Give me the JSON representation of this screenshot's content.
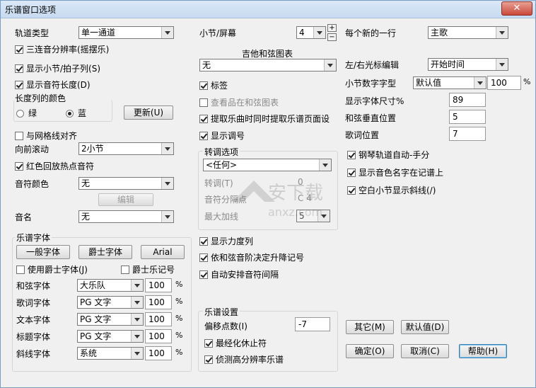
{
  "window": {
    "title": "乐谱窗口选项",
    "close": "✕"
  },
  "left": {
    "track_type_label": "轨道类型",
    "track_type_value": "单一通道",
    "triplet_cb": "三连音分辨率(摇摆乐)",
    "show_bar_beat_cb": "显示小节/拍子列(S)",
    "show_note_length_cb": "显示音符长度(D)",
    "length_color_label": "长度列的颜色",
    "radio_green": "绿",
    "radio_blue": "蓝",
    "update_btn": "更新(U)",
    "grid_align_cb": "与网格线对齐",
    "forward_scroll_label": "向前滚动",
    "forward_scroll_value": "2小节",
    "red_playback_cb": "红色回放热点音符",
    "note_color_label": "音符颜色",
    "note_color_value": "无",
    "edit_btn": "编辑",
    "note_name_label": "音名",
    "note_name_value": "无"
  },
  "fonts": {
    "group_label": "乐谱字体",
    "general_btn": "一般字体",
    "jazz_btn": "爵士字体",
    "arial_btn": "Arial",
    "use_jazz_cb": "使用爵士字体(J)",
    "jazz_symbols_cb": "爵士乐记号",
    "rows": [
      {
        "label": "和弦字体",
        "font": "大乐队",
        "size": "100",
        "unit": "%"
      },
      {
        "label": "歌词字体",
        "font": "PG 文字",
        "size": "100",
        "unit": "%"
      },
      {
        "label": "文本字体",
        "font": "PG 文字",
        "size": "100",
        "unit": "%"
      },
      {
        "label": "标题字体",
        "font": "PG 文字",
        "size": "100",
        "unit": "%"
      },
      {
        "label": "斜线字体",
        "font": "系统",
        "size": "100",
        "unit": "%"
      }
    ]
  },
  "middle": {
    "bars_per_screen_label": "小节/屏幕",
    "bars_per_screen_value": "4",
    "plus": "+",
    "minus": "−",
    "guitar_chord_label": "吉他和弦图表",
    "guitar_chord_value": "无",
    "tab_cb": "标签",
    "view_chord_cb": "查看品在和弦图表",
    "extract_page_cb": "提取乐曲时同时提取乐谱页面设",
    "show_key_cb": "显示调号",
    "transpose_group_label": "转调选项",
    "transpose_value": "<任何>",
    "transpose_label": "转调(T)",
    "transpose_num": "0",
    "split_point_label": "音符分隔点",
    "split_point_value": "C 4",
    "max_ledger_label": "最大加线",
    "max_ledger_value": "5",
    "show_dynamics_cb": "显示力度列",
    "sharps_flats_cb": "依和弦音阶决定升降记号",
    "auto_spacing_cb": "自动安排音符间隔",
    "score_settings_label": "乐谱设置",
    "offset_label": "偏移点数(I)",
    "offset_value": "-7",
    "minimize_rests_cb": "最经化休止符",
    "detect_hires_cb": "侦测高分辨率乐谱"
  },
  "right": {
    "new_line_label": "每个新的一行",
    "new_line_value": "主歌",
    "cursor_edit_label": "左/右光标编辑",
    "cursor_edit_value": "开始时间",
    "bar_number_font_label": "小节数字字型",
    "bar_number_font_value": "默认值",
    "bar_number_size": "100",
    "bar_number_unit": "%",
    "display_font_size_label": "显示字体尺寸%",
    "display_font_size_value": "89",
    "chord_vertical_label": "和弦垂直位置",
    "chord_vertical_value": "5",
    "lyric_position_label": "歌词位置",
    "lyric_position_value": "7",
    "piano_auto_cb": "钢琴轨道自动-手分",
    "show_color_names_cb": "显示音色名字在记谱上",
    "empty_bar_slash_cb": "空白小节显示斜线(/)",
    "other_btn": "其它(M)",
    "default_btn": "默认值(D)",
    "ok_btn": "确定(O)",
    "cancel_btn": "取消(C)",
    "help_btn": "帮助(H)"
  },
  "watermark": {
    "text_cn": "安下载",
    "text_en": "anxz.com"
  }
}
